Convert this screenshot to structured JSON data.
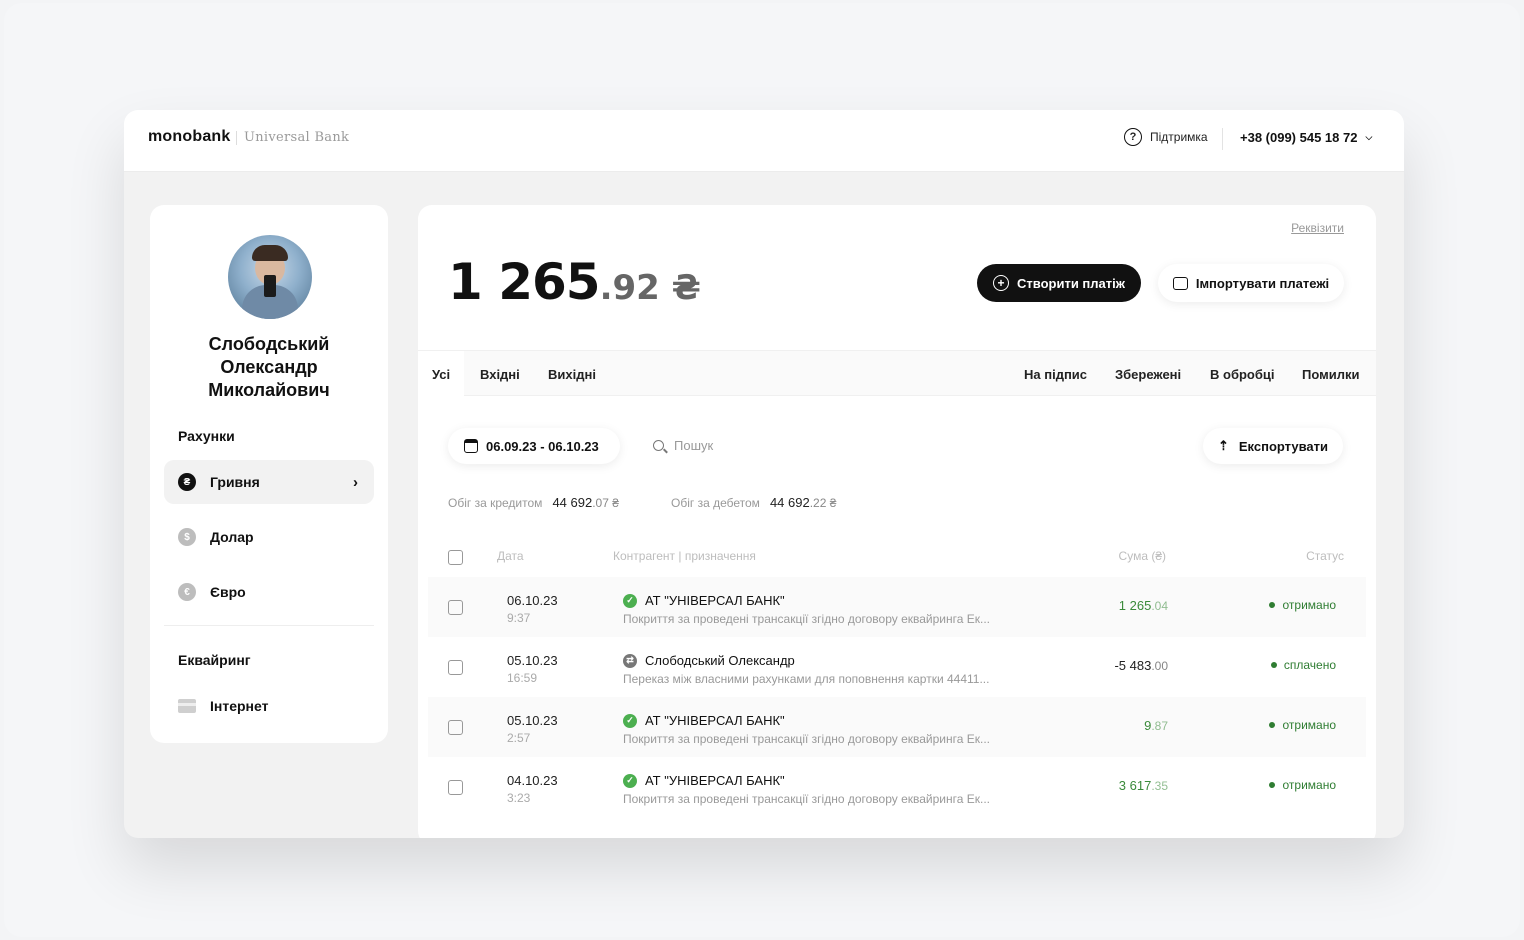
{
  "colors": {
    "accent": "#111111",
    "positive": "#3a8a3a",
    "status_green": "#2f7d32",
    "icon_green": "#4caf50",
    "icon_gray": "#9e9e9e"
  },
  "header": {
    "logo": "monobank",
    "logo_sub": "Universal Bank",
    "support_label": "Підтримка",
    "phone": "+38 (099) 545 18 72"
  },
  "sidebar": {
    "user_name_lines": [
      "Слобoдський",
      "Олександр",
      "Миколайович"
    ],
    "accounts_title": "Рахунки",
    "accounts": [
      {
        "label": "Гривня",
        "icon": "hryvnia-icon",
        "symbol": "₴"
      },
      {
        "label": "Долар",
        "icon": "dollar-icon",
        "symbol": "$"
      },
      {
        "label": "Євро",
        "icon": "euro-icon",
        "symbol": "€"
      }
    ],
    "acquiring_title": "Еквайринг",
    "acquiring_items": [
      {
        "label": "Інтернет",
        "icon": "card-icon"
      }
    ]
  },
  "main": {
    "requisites_link": "Реквізити",
    "balance_int": "1 265",
    "balance_dec": ".92 ₴",
    "create_payment": "Створити платіж",
    "import_payments": "Імпортувати платежі",
    "tabs_left": [
      "Усі",
      "Вхідні",
      "Вихідні"
    ],
    "tabs_right": [
      "На підпис",
      "Збережені",
      "В обробці",
      "Помилки"
    ],
    "date_range": "06.09.23 - 06.10.23",
    "search_placeholder": "Пошук",
    "export": "Експортувати",
    "credit_turnover_label": "Обіг за кредитом",
    "credit_turnover_int": "44 692",
    "credit_turnover_dec": ".07 ₴",
    "debit_turnover_label": "Обіг за дебетом",
    "debit_turnover_int": "44 692",
    "debit_turnover_dec": ".22 ₴",
    "columns": {
      "date": "Дата",
      "counterparty": "Контрагент | призначення",
      "amount": "Сума (₴)",
      "status": "Статус"
    },
    "transactions": [
      {
        "date": "06.10.23",
        "time": "9:37",
        "name": "АТ \"УНІВЕРСАЛ БАНК\"",
        "desc": "Покриття за проведені трансакції згідно договору еквайринга Ек...",
        "amount_int": "1 265",
        "amount_dec": ".04",
        "status": "отримано",
        "kind": "in"
      },
      {
        "date": "05.10.23",
        "time": "16:59",
        "name": "Слободський Олександр",
        "desc": "Переказ між власними рахунками для поповнення картки 44411...",
        "amount_int": "-5 483",
        "amount_dec": ".00",
        "status": "сплачено",
        "kind": "out"
      },
      {
        "date": "05.10.23",
        "time": "2:57",
        "name": "АТ \"УНІВЕРСАЛ БАНК\"",
        "desc": "Покриття за проведені трансакції згідно договору еквайринга Ек...",
        "amount_int": "9",
        "amount_dec": ".87",
        "status": "отримано",
        "kind": "in"
      },
      {
        "date": "04.10.23",
        "time": "3:23",
        "name": "АТ \"УНІВЕРСАЛ БАНК\"",
        "desc": "Покриття за проведені трансакції згідно договору еквайринга Ек...",
        "amount_int": "3 617",
        "amount_dec": ".35",
        "status": "отримано",
        "kind": "in"
      }
    ]
  }
}
